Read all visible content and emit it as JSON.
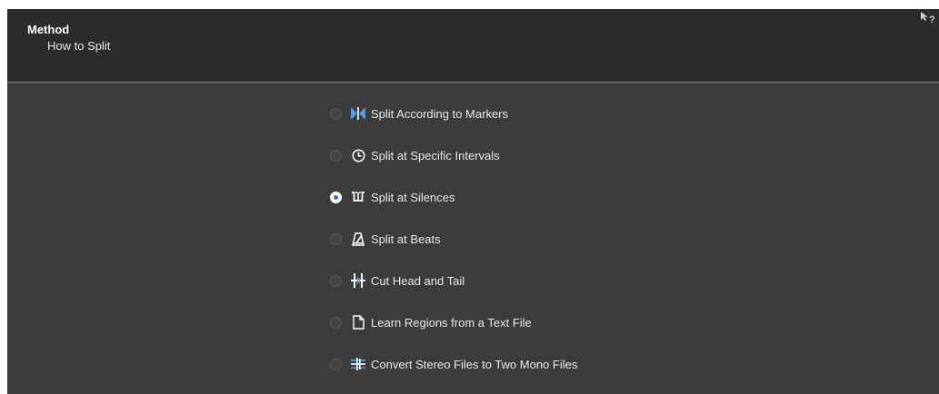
{
  "header": {
    "title": "Method",
    "subtitle": "How to Split",
    "help_icon": "whats-this-help-icon"
  },
  "options": [
    {
      "label": "Split According to Markers",
      "icon": "markers-icon",
      "selected": false
    },
    {
      "label": "Split at Specific Intervals",
      "icon": "clock-icon",
      "selected": false
    },
    {
      "label": "Split at Silences",
      "icon": "silence-icon",
      "selected": true
    },
    {
      "label": "Split at Beats",
      "icon": "metronome-icon",
      "selected": false
    },
    {
      "label": "Cut Head and Tail",
      "icon": "cut-head-tail-icon",
      "selected": false
    },
    {
      "label": "Learn Regions from a Text File",
      "icon": "text-file-icon",
      "selected": false
    },
    {
      "label": "Convert Stereo Files to Two Mono Files",
      "icon": "stereo-to-mono-icon",
      "selected": false
    }
  ],
  "colors": {
    "panel_bg": "#3c3c3c",
    "header_bg": "#2b2b2b",
    "accent_blue": "#4a9fe8",
    "selected_radio": "#2c6fd6"
  }
}
